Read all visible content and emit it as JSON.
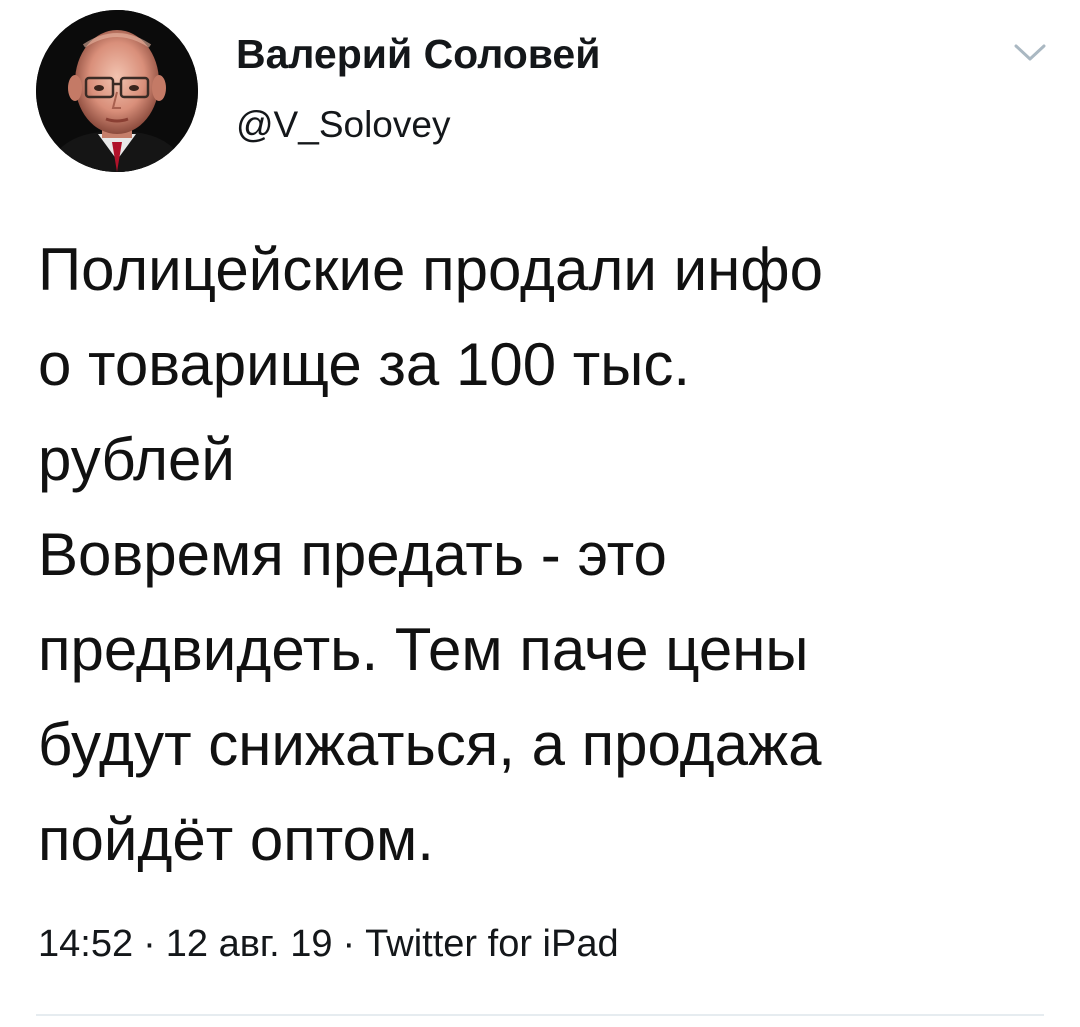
{
  "author": {
    "display_name": "Валерий Соловей",
    "handle": "@V_Solovey"
  },
  "tweet": {
    "lines": [
      "Полицейские продали инфо",
      "о товарище за 100 тыс.",
      "рублей",
      "Вовремя предать - это",
      "предвидеть. Тем паче цены",
      "будут снижаться, а продажа",
      "пойдёт оптом."
    ]
  },
  "meta": {
    "time": "14:52",
    "date": "12 авг. 19",
    "source": "Twitter for iPad",
    "separator": "·"
  },
  "icons": {
    "menu": "chevron-down-icon",
    "avatar": "avatar"
  },
  "colors": {
    "text": "#14171a",
    "chevron": "#aab8c2",
    "divider": "#e6ecf0"
  }
}
